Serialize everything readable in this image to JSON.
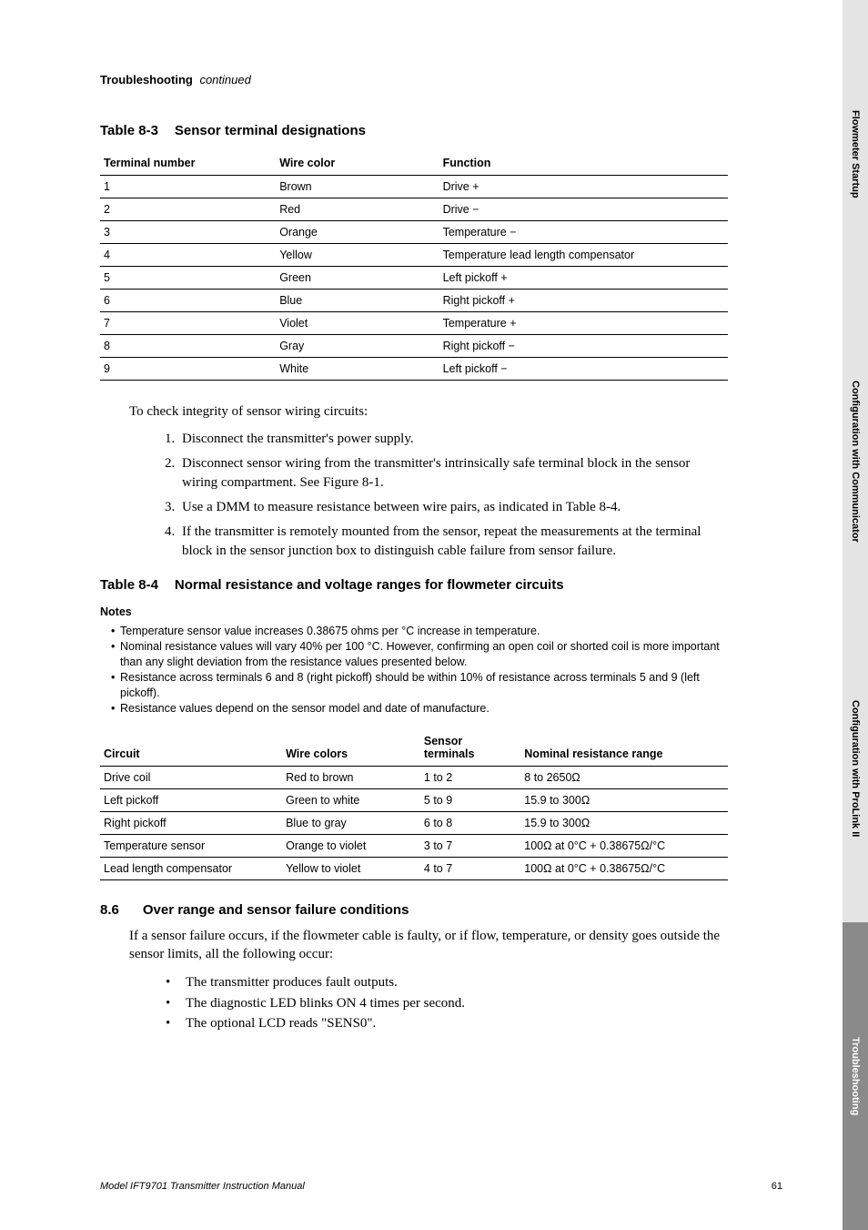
{
  "running_head": {
    "bold": "Troubleshooting",
    "italic": "continued"
  },
  "table83": {
    "caption_num": "Table 8-3",
    "caption_title": "Sensor terminal designations",
    "headers": [
      "Terminal number",
      "Wire color",
      "Function"
    ],
    "rows": [
      [
        "1",
        "Brown",
        "Drive +"
      ],
      [
        "2",
        "Red",
        "Drive −"
      ],
      [
        "3",
        "Orange",
        "Temperature −"
      ],
      [
        "4",
        "Yellow",
        "Temperature lead length compensator"
      ],
      [
        "5",
        "Green",
        "Left pickoff +"
      ],
      [
        "6",
        "Blue",
        "Right pickoff +"
      ],
      [
        "7",
        "Violet",
        "Temperature +"
      ],
      [
        "8",
        "Gray",
        "Right pickoff −"
      ],
      [
        "9",
        "White",
        "Left pickoff −"
      ]
    ]
  },
  "intro84": "To check integrity of sensor wiring circuits:",
  "steps84": [
    "Disconnect the transmitter's power supply.",
    "Disconnect sensor wiring from the transmitter's intrinsically safe terminal block in the sensor wiring compartment. See Figure 8-1.",
    "Use a DMM to measure resistance between wire pairs, as indicated in Table 8-4.",
    "If the transmitter is remotely mounted from the sensor, repeat the measurements at the terminal block in the sensor junction box to distinguish cable failure from sensor failure."
  ],
  "table84": {
    "caption_num": "Table 8-4",
    "caption_title": "Normal resistance and voltage ranges for flowmeter circuits",
    "notes_head": "Notes",
    "notes": [
      "Temperature sensor value increases 0.38675 ohms per °C increase in temperature.",
      "Nominal resistance values will vary 40% per 100 °C. However, confirming an open coil or shorted coil is more important than any slight deviation from the resistance values presented below.",
      "Resistance across terminals 6 and 8 (right pickoff) should be within 10% of resistance across terminals 5 and 9 (left pickoff).",
      "Resistance values depend on the sensor model and date of manufacture."
    ],
    "headers": [
      "Circuit",
      "Wire colors",
      "Sensor terminals",
      "Nominal resistance range"
    ],
    "rows": [
      [
        "Drive coil",
        "Red to brown",
        "1 to 2",
        "8 to 2650Ω"
      ],
      [
        "Left pickoff",
        "Green to white",
        "5 to 9",
        "15.9 to 300Ω"
      ],
      [
        "Right pickoff",
        "Blue to gray",
        "6 to 8",
        "15.9 to 300Ω"
      ],
      [
        "Temperature sensor",
        "Orange to violet",
        "3 to 7",
        "100Ω at 0°C + 0.38675Ω/°C"
      ],
      [
        "Lead length compensator",
        "Yellow to violet",
        "4 to 7",
        "100Ω at 0°C + 0.38675Ω/°C"
      ]
    ]
  },
  "section86": {
    "num": "8.6",
    "title": "Over range and sensor failure conditions",
    "para": "If a sensor failure occurs, if the flowmeter cable is faulty, or if flow, temperature, or density goes outside the sensor limits, all the following occur:",
    "bullets": [
      "The transmitter produces fault outputs.",
      "The diagnostic LED blinks ON 4 times per second.",
      "The optional LCD reads \"SENS0\"."
    ]
  },
  "footer": {
    "left": "Model IFT9701 Transmitter Instruction Manual",
    "page": "61"
  },
  "tabs": [
    {
      "label": "Flowmeter Startup",
      "shade": "light"
    },
    {
      "label": "Configuration with Communicator",
      "shade": "light"
    },
    {
      "label": "Configuration with ProLink II",
      "shade": "light"
    },
    {
      "label": "Troubleshooting",
      "shade": "dark"
    }
  ],
  "chart_data": [
    {
      "type": "table",
      "title": "Sensor terminal designations",
      "columns": [
        "Terminal number",
        "Wire color",
        "Function"
      ],
      "rows": [
        [
          1,
          "Brown",
          "Drive +"
        ],
        [
          2,
          "Red",
          "Drive −"
        ],
        [
          3,
          "Orange",
          "Temperature −"
        ],
        [
          4,
          "Yellow",
          "Temperature lead length compensator"
        ],
        [
          5,
          "Green",
          "Left pickoff +"
        ],
        [
          6,
          "Blue",
          "Right pickoff +"
        ],
        [
          7,
          "Violet",
          "Temperature +"
        ],
        [
          8,
          "Gray",
          "Right pickoff −"
        ],
        [
          9,
          "White",
          "Left pickoff −"
        ]
      ]
    },
    {
      "type": "table",
      "title": "Normal resistance and voltage ranges for flowmeter circuits",
      "columns": [
        "Circuit",
        "Wire colors",
        "Sensor terminals",
        "Nominal resistance range"
      ],
      "rows": [
        [
          "Drive coil",
          "Red to brown",
          "1 to 2",
          "8 to 2650 Ω"
        ],
        [
          "Left pickoff",
          "Green to white",
          "5 to 9",
          "15.9 to 300 Ω"
        ],
        [
          "Right pickoff",
          "Blue to gray",
          "6 to 8",
          "15.9 to 300 Ω"
        ],
        [
          "Temperature sensor",
          "Orange to violet",
          "3 to 7",
          "100 Ω at 0°C + 0.38675 Ω/°C"
        ],
        [
          "Lead length compensator",
          "Yellow to violet",
          "4 to 7",
          "100 Ω at 0°C + 0.38675 Ω/°C"
        ]
      ]
    }
  ]
}
